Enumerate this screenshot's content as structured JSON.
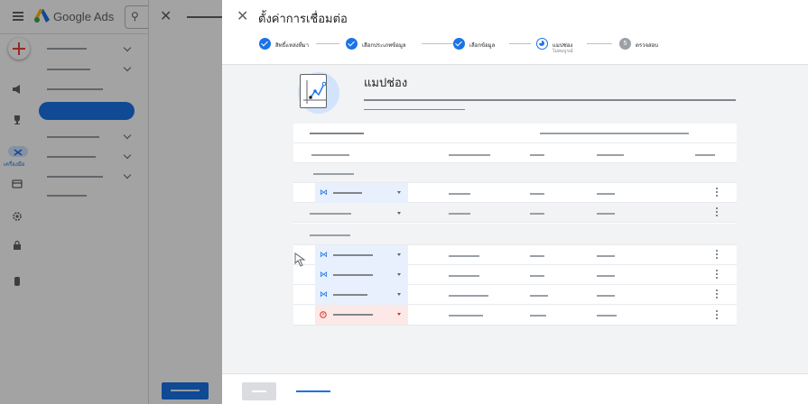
{
  "app": {
    "brand_name": "Google Ads",
    "tools_label": "เครื่องมือ",
    "logo_icon": "google-ads-logo",
    "colors": {
      "accent": "#1a73e8",
      "error": "#ea4335",
      "scrim": "#000000"
    }
  },
  "dialog": {
    "title": "ตั้งค่าการเชื่อมต่อ",
    "close_icon": "close-icon",
    "steps": [
      {
        "label": "สิทธิ์แหล่งที่มา",
        "status": "complete"
      },
      {
        "label": "เลือกประเภทข้อมูล",
        "status": "complete"
      },
      {
        "label": "เลือกข้อมูล",
        "status": "complete"
      },
      {
        "label": "แมปช่อง",
        "sublabel": "ไม่สมบูรณ์",
        "status": "current"
      },
      {
        "label": "ตรวจสอบ",
        "number": "5",
        "status": "pending"
      }
    ],
    "section": {
      "title": "แมปช่อง",
      "icon": "chart-mapping-icon"
    },
    "table": {
      "row_icons": {
        "mapped": "magic-wand-icon",
        "error": "error-circle-icon",
        "menu": "more-vert-icon",
        "dropdown": "dropdown-caret-icon"
      },
      "row_states": [
        "header",
        "group",
        "mapped",
        "plain",
        "group",
        "mapped",
        "mapped",
        "mapped",
        "error"
      ]
    }
  }
}
